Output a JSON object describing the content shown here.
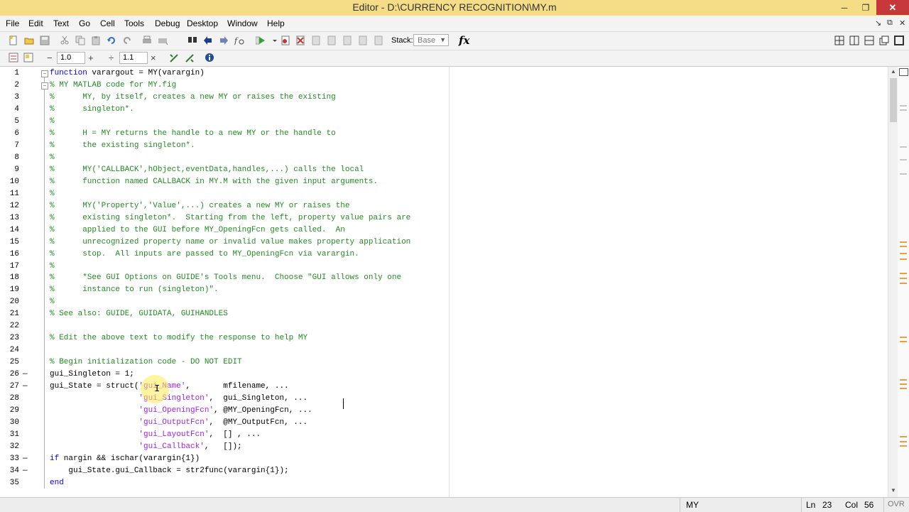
{
  "window": {
    "title": "Editor - D:\\CURRENCY RECOGNITION\\MY.m",
    "controls": [
      "─",
      "❐",
      "✕"
    ]
  },
  "menu": [
    "File",
    "Edit",
    "Text",
    "Go",
    "Cell",
    "Tools",
    "Debug",
    "Desktop",
    "Window",
    "Help"
  ],
  "menu_right": [
    "↘",
    "⧉",
    "✕"
  ],
  "toolbar": {
    "stack_label": "Stack:",
    "stack_value": "Base",
    "fx_label": "fx"
  },
  "cell_toolbar": {
    "minus": "−",
    "value1": "1.0",
    "plus": "+",
    "divide": "÷",
    "value2": "1.1",
    "times": "×"
  },
  "code": [
    {
      "n": "1",
      "parts": [
        {
          "t": "kw",
          "s": "function"
        },
        {
          "t": "p",
          "s": " varargout = MY(varargin)"
        }
      ]
    },
    {
      "n": "2",
      "parts": [
        {
          "t": "cm",
          "s": "% MY MATLAB code for MY.fig"
        }
      ]
    },
    {
      "n": "3",
      "parts": [
        {
          "t": "cm",
          "s": "%      MY, by itself, creates a new MY or raises the existing"
        }
      ]
    },
    {
      "n": "4",
      "parts": [
        {
          "t": "cm",
          "s": "%      singleton*."
        }
      ]
    },
    {
      "n": "5",
      "parts": [
        {
          "t": "cm",
          "s": "%"
        }
      ]
    },
    {
      "n": "6",
      "parts": [
        {
          "t": "cm",
          "s": "%      H = MY returns the handle to a new MY or the handle to"
        }
      ]
    },
    {
      "n": "7",
      "parts": [
        {
          "t": "cm",
          "s": "%      the existing singleton*."
        }
      ]
    },
    {
      "n": "8",
      "parts": [
        {
          "t": "cm",
          "s": "%"
        }
      ]
    },
    {
      "n": "9",
      "parts": [
        {
          "t": "cm",
          "s": "%      MY('CALLBACK',hObject,eventData,handles,...) calls the local"
        }
      ]
    },
    {
      "n": "10",
      "parts": [
        {
          "t": "cm",
          "s": "%      function named CALLBACK in MY.M with the given input arguments."
        }
      ]
    },
    {
      "n": "11",
      "parts": [
        {
          "t": "cm",
          "s": "%"
        }
      ]
    },
    {
      "n": "12",
      "parts": [
        {
          "t": "cm",
          "s": "%      MY('Property','Value',...) creates a new MY or raises the"
        }
      ]
    },
    {
      "n": "13",
      "parts": [
        {
          "t": "cm",
          "s": "%      existing singleton*.  Starting from the left, property value pairs are"
        }
      ]
    },
    {
      "n": "14",
      "parts": [
        {
          "t": "cm",
          "s": "%      applied to the GUI before MY_OpeningFcn gets called.  An"
        }
      ]
    },
    {
      "n": "15",
      "parts": [
        {
          "t": "cm",
          "s": "%      unrecognized property name or invalid value makes property application"
        }
      ]
    },
    {
      "n": "16",
      "parts": [
        {
          "t": "cm",
          "s": "%      stop.  All inputs are passed to MY_OpeningFcn via varargin."
        }
      ]
    },
    {
      "n": "17",
      "parts": [
        {
          "t": "cm",
          "s": "%"
        }
      ]
    },
    {
      "n": "18",
      "parts": [
        {
          "t": "cm",
          "s": "%      *See GUI Options on GUIDE's Tools menu.  Choose \"GUI allows only one"
        }
      ]
    },
    {
      "n": "19",
      "parts": [
        {
          "t": "cm",
          "s": "%      instance to run (singleton)\"."
        }
      ]
    },
    {
      "n": "20",
      "parts": [
        {
          "t": "cm",
          "s": "%"
        }
      ]
    },
    {
      "n": "21",
      "parts": [
        {
          "t": "cm",
          "s": "% See also: GUIDE, GUIDATA, GUIHANDLES"
        }
      ]
    },
    {
      "n": "22",
      "parts": []
    },
    {
      "n": "23",
      "parts": [
        {
          "t": "cm",
          "s": "% Edit the above text to modify the response to help MY"
        }
      ]
    },
    {
      "n": "24",
      "parts": []
    },
    {
      "n": "25",
      "parts": [
        {
          "t": "cm",
          "s": "% Begin initialization code - DO NOT EDIT"
        }
      ]
    },
    {
      "n": "26",
      "parts": [
        {
          "t": "p",
          "s": "gui_Singleton = 1;"
        }
      ]
    },
    {
      "n": "27",
      "parts": [
        {
          "t": "p",
          "s": "gui_State = struct("
        },
        {
          "t": "str",
          "s": "'gui_Name'"
        },
        {
          "t": "p",
          "s": ",       mfilename, ..."
        }
      ]
    },
    {
      "n": "28",
      "parts": [
        {
          "t": "p",
          "s": "                   "
        },
        {
          "t": "str",
          "s": "'gui_Singleton'"
        },
        {
          "t": "p",
          "s": ",  gui_Singleton, ..."
        }
      ]
    },
    {
      "n": "29",
      "parts": [
        {
          "t": "p",
          "s": "                   "
        },
        {
          "t": "str",
          "s": "'gui_OpeningFcn'"
        },
        {
          "t": "p",
          "s": ", @MY_OpeningFcn, ..."
        }
      ]
    },
    {
      "n": "30",
      "parts": [
        {
          "t": "p",
          "s": "                   "
        },
        {
          "t": "str",
          "s": "'gui_OutputFcn'"
        },
        {
          "t": "p",
          "s": ",  @MY_OutputFcn, ..."
        }
      ]
    },
    {
      "n": "31",
      "parts": [
        {
          "t": "p",
          "s": "                   "
        },
        {
          "t": "str",
          "s": "'gui_LayoutFcn'"
        },
        {
          "t": "p",
          "s": ",  [] , ..."
        }
      ]
    },
    {
      "n": "32",
      "parts": [
        {
          "t": "p",
          "s": "                   "
        },
        {
          "t": "str",
          "s": "'gui_Callback'"
        },
        {
          "t": "p",
          "s": ",   []);"
        }
      ]
    },
    {
      "n": "33",
      "parts": [
        {
          "t": "kw",
          "s": "if"
        },
        {
          "t": "p",
          "s": " nargin && ischar(varargin{1})"
        }
      ]
    },
    {
      "n": "34",
      "parts": [
        {
          "t": "p",
          "s": "    gui_State.gui_Callback = str2func(varargin{1});"
        }
      ]
    },
    {
      "n": "35",
      "parts": [
        {
          "t": "kw",
          "s": "end"
        }
      ]
    }
  ],
  "dash_lines": [
    "26",
    "27",
    "33",
    "34"
  ],
  "status": {
    "function_name": "MY",
    "ln_label": "Ln",
    "ln_value": "23",
    "col_label": "Col",
    "col_value": "56",
    "mode": "OVR"
  },
  "colors": {
    "comment": "#228b22",
    "string": "#a020f0",
    "keyword": "#0000ff",
    "titlebar": "#f5dd88"
  }
}
